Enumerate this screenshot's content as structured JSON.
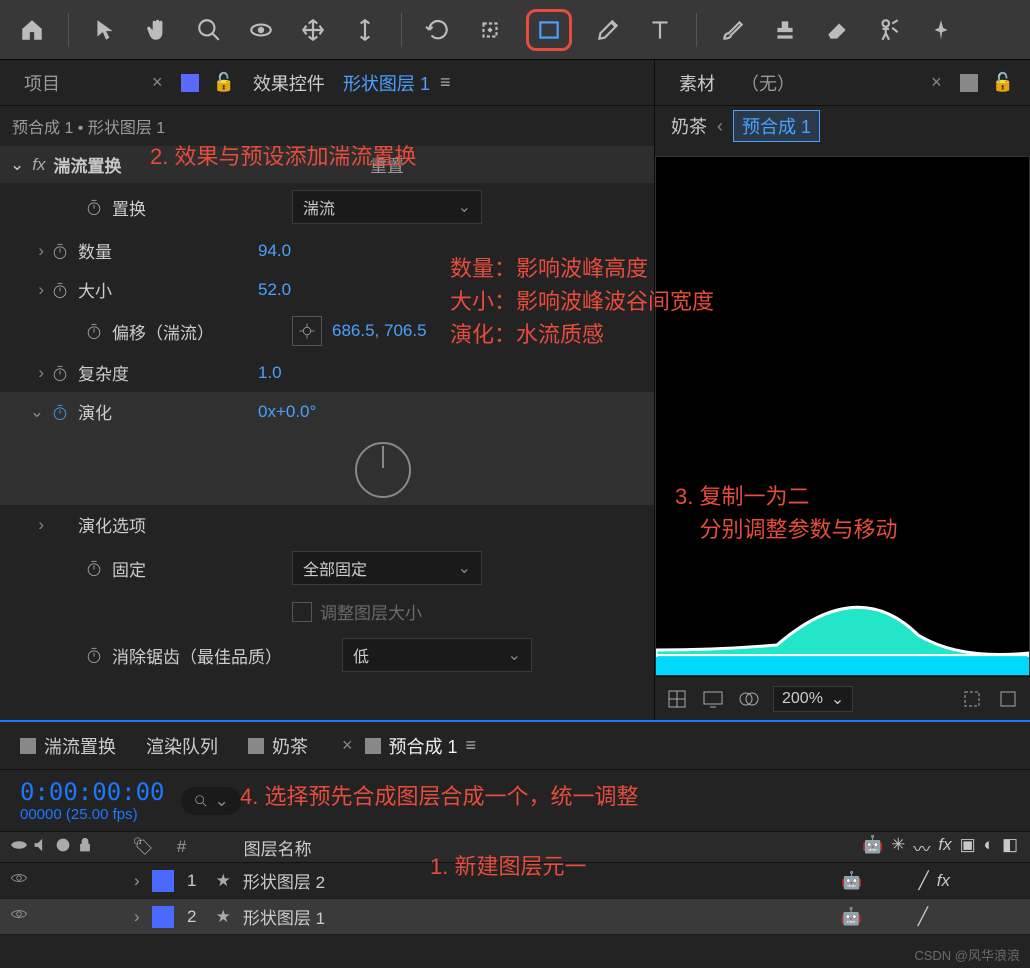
{
  "toolbar": {
    "tools": [
      "home",
      "select",
      "hand",
      "zoom",
      "orbit",
      "pan",
      "dolly",
      "rotate",
      "anchor",
      "rect",
      "pen",
      "text",
      "brush",
      "stamp",
      "eraser",
      "roto",
      "pin"
    ]
  },
  "leftPanel": {
    "tabs": {
      "project": "项目",
      "effectControls": "效果控件",
      "layerLink": "形状图层 1"
    },
    "breadcrumb": "预合成 1 • 形状图层 1",
    "effect": {
      "name": "湍流置换",
      "reset": "重置",
      "props": {
        "displacement": {
          "label": "置换",
          "value": "湍流"
        },
        "amount": {
          "label": "数量",
          "value": "94.0"
        },
        "size": {
          "label": "大小",
          "value": "52.0"
        },
        "offset": {
          "label": "偏移（湍流）",
          "value": "686.5, 706.5"
        },
        "complexity": {
          "label": "复杂度",
          "value": "1.0"
        },
        "evolution": {
          "label": "演化",
          "value": "0x+0.0°"
        },
        "evoOptions": {
          "label": "演化选项"
        },
        "pinning": {
          "label": "固定",
          "value": "全部固定"
        },
        "resize": {
          "label": "调整图层大小"
        },
        "antialias": {
          "label": "消除锯齿（最佳品质）",
          "value": "低"
        }
      }
    }
  },
  "rightPanel": {
    "tabs": {
      "footage": "素材",
      "none": "（无）"
    },
    "breadcrumb": {
      "milk": "奶茶",
      "precomp": "预合成 1"
    },
    "zoom": "200%"
  },
  "timeline": {
    "tabs": {
      "turbulent": "湍流置换",
      "renderQueue": "渲染队列",
      "milkTea": "奶茶",
      "precomp": "预合成 1"
    },
    "timecode": "0:00:00:00",
    "framesFps": "00000 (25.00 fps)",
    "layerNameHeader": "图层名称",
    "hash": "#",
    "layers": [
      {
        "index": "1",
        "name": "形状图层 2"
      },
      {
        "index": "2",
        "name": "形状图层 1"
      }
    ]
  },
  "annotations": {
    "a1": "1. 新建图层元一",
    "a2": "2. 效果与预设添加湍流置换",
    "a3": "3. 复制一为二\n    分别调整参数与移动",
    "a4": "4. 选择预先合成图层合成一个，统一调整",
    "notes": "数量：影响波峰高度\n大小：影响波峰波谷间宽度\n演化：水流质感"
  },
  "watermark": "CSDN @风华浪浪"
}
